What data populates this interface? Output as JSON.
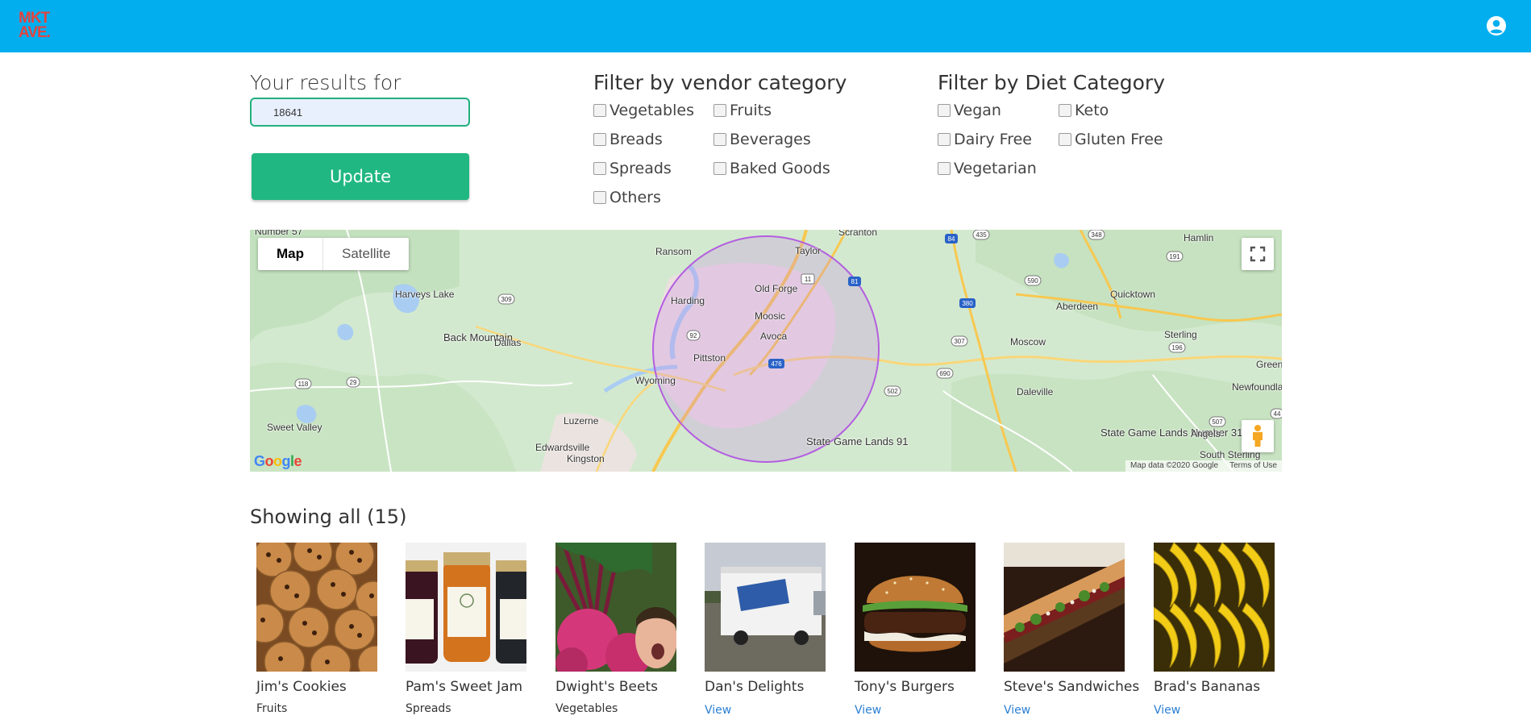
{
  "header": {
    "logo_line1": "MKT",
    "logo_line2": "AVE.",
    "bg_color": "#03aeef",
    "account_icon": "account-circle-icon"
  },
  "search": {
    "label": "Your results for",
    "value": "18641",
    "button_label": "Update"
  },
  "vendor_filter": {
    "title": "Filter by vendor category",
    "options": [
      "Vegetables",
      "Fruits",
      "Breads",
      "Beverages",
      "Spreads",
      "Baked Goods",
      "Others"
    ]
  },
  "diet_filter": {
    "title": "Filter by Diet Category",
    "options": [
      "Vegan",
      "Keto",
      "Dairy Free",
      "Gluten Free",
      "Vegetarian"
    ]
  },
  "map": {
    "type_buttons": [
      "Map",
      "Satellite"
    ],
    "active_type": "Map",
    "google_logo": "Google",
    "attribution": "Map data ©2020 Google",
    "terms": "Terms of Use",
    "places": [
      "Number 57",
      "Scranton",
      "Ransom",
      "Taylor",
      "Harveys Lake",
      "Old Forge",
      "Harding",
      "Moosic",
      "Back Mountain",
      "Dallas",
      "Avoca",
      "Pittston",
      "Wyoming",
      "Sweet Valley",
      "Luzerne",
      "Edwardsville",
      "Kingston",
      "State Game Lands 91",
      "Hamlin",
      "Quicktown",
      "Aberdeen",
      "Moscow",
      "Sterling",
      "Green",
      "Newfoundla",
      "Daleville",
      "State Game Lands Number 312",
      "Angels",
      "South Sterling"
    ],
    "road_shields": [
      "11",
      "81",
      "309",
      "92",
      "476",
      "29",
      "118",
      "84",
      "435",
      "380",
      "307",
      "690",
      "502",
      "348",
      "191",
      "590",
      "196",
      "507",
      "44"
    ]
  },
  "results": {
    "label": "Showing all (15)",
    "vendors": [
      {
        "name": "Jim's Cookies",
        "sub": "Fruits",
        "link": "",
        "image": "cookies-photo"
      },
      {
        "name": "Pam's Sweet Jam",
        "sub": "Spreads",
        "link": "",
        "image": "jam-jars-photo"
      },
      {
        "name": "Dwight's Beets",
        "sub": "Vegetables",
        "link": "",
        "image": "beets-photo"
      },
      {
        "name": "Dan's Delights",
        "sub": "",
        "link": "View",
        "image": "food-truck-photo"
      },
      {
        "name": "Tony's Burgers",
        "sub": "",
        "link": "View",
        "image": "burger-photo"
      },
      {
        "name": "Steve's Sandwiches",
        "sub": "",
        "link": "View",
        "image": "sandwich-photo"
      },
      {
        "name": "Brad's Bananas",
        "sub": "",
        "link": "View",
        "image": "bananas-photo"
      }
    ]
  },
  "colors": {
    "accent_green": "#21b783",
    "header_blue": "#03aeef",
    "logo_red": "#e2443f",
    "link_blue": "#2a7fd4",
    "radius_circle": "#b35fe0"
  }
}
